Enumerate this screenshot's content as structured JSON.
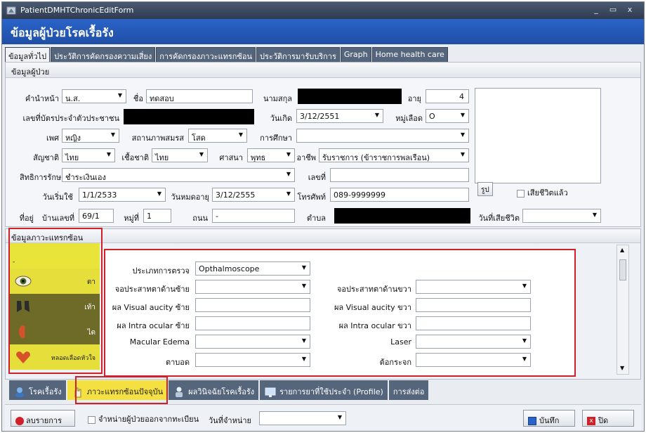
{
  "window": {
    "title": "PatientDMHTChronicEditForm",
    "min": "_",
    "max": "▭",
    "close": "x"
  },
  "banner": "ข้อมูลผู้ป่วยโรคเรื้อรัง",
  "tabs": [
    "ข้อมูลทั่วไป",
    "ประวัติการคัดกรองความเสี่ยง",
    "การคัดกรองภาวะแทรกซ้อน",
    "ประวัติการมารับบริการ",
    "Graph",
    "Home health care"
  ],
  "patient_section": "ข้อมูลผู้ป่วย",
  "form": {
    "prefix_label": "คำนำหน้า",
    "prefix_value": "น.ส.",
    "name_label": "ชื่อ",
    "name_value": "ทดสอบ",
    "surname_label": "นามสกุล",
    "age_label": "อายุ",
    "age_value": "4",
    "idcard_label": "เลขที่บัตรประจำตัวประชาชน",
    "birth_label": "วันเกิด",
    "birth_value": "3/12/2551",
    "blood_label": "หมู่เลือด",
    "blood_value": "O",
    "sex_label": "เพศ",
    "sex_value": "หญิง",
    "marital_label": "สถานภาพสมรส",
    "marital_value": "โสด",
    "edu_label": "การศึกษา",
    "edu_value": "",
    "nation_label": "สัญชาติ",
    "nation_value": "ไทย",
    "race_label": "เชื้อชาติ",
    "race_value": "ไทย",
    "religion_label": "ศาสนา",
    "religion_value": "พุทธ",
    "occupation_label": "อาชีพ",
    "occupation_value": "รับราชการ (ข้าราชการพลเรือน)",
    "right_label": "สิทธิการรักษา",
    "right_value": "ชำระเงินเอง",
    "no_label": "เลขที่",
    "no_value": "",
    "start_label": "วันเริ่มใช้",
    "start_value": "1/1/2533",
    "expire_label": "วันหมดอายุ",
    "expire_value": "3/12/2555",
    "phone_label": "โทรศัพท์",
    "phone_value": "089-9999999",
    "address_label": "ที่อยู่",
    "house_label": "บ้านเลขที่",
    "house_value": "69/1",
    "moo_label": "หมู่ที่",
    "moo_value": "1",
    "road_label": "ถนน",
    "road_value": "-",
    "subdistrict_label": "ตำบล",
    "death_label": "วันที่เสียชีวิต",
    "death_value": "",
    "photo_button": "รูป",
    "deceased_label": "เสียชีวิตแล้ว"
  },
  "complication_section": "ข้อมูลภาวะแทรกซ้อน",
  "side_items": [
    {
      "label": "ตา",
      "icon": "eye-icon"
    },
    {
      "label": "เท้า",
      "icon": "foot-icon"
    },
    {
      "label": "ไต",
      "icon": "kidney-icon"
    },
    {
      "label": "หลอดเลือดหัวใจ",
      "icon": "heart-icon"
    }
  ],
  "exam": {
    "type_label": "ประเภทการตรวจ",
    "type_value": "Opthalmoscope",
    "left_retina_label": "จอประสาทตาด้านซ้าย",
    "right_retina_label": "จอประสาทตาด้านขวา",
    "va_left_label": "ผล Visual aucity ซ้าย",
    "va_right_label": "ผล Visual aucity ขวา",
    "io_left_label": "ผล Intra ocular ซ้าย",
    "io_right_label": "ผล Intra ocular ขวา",
    "macular_label": "Macular Edema",
    "laser_label": "Laser",
    "blind_label": "ตาบอด",
    "glaucoma_label": "ต้อกระจก"
  },
  "bottom_tabs": [
    "โรคเรื้อรัง",
    "ภาวะแทรกซ้อนปัจจุบัน",
    "ผลวินิจฉัยโรคเรื้อรัง",
    "รายการยาที่ใช้ประจำ (Profile)",
    "การส่งต่อ"
  ],
  "footer": {
    "delete_button": "ลบรายการ",
    "discharge_label": "จำหน่ายผู้ป่วยออกจากทะเบียน",
    "discharge_date_label": "วันที่จำหน่าย",
    "save_button": "บันทึก",
    "close_button": "ปิด"
  },
  "colors": {
    "accent_blue": "#1f4fa6",
    "highlight_yellow": "#f4e040",
    "outline_red": "#d0202a"
  }
}
